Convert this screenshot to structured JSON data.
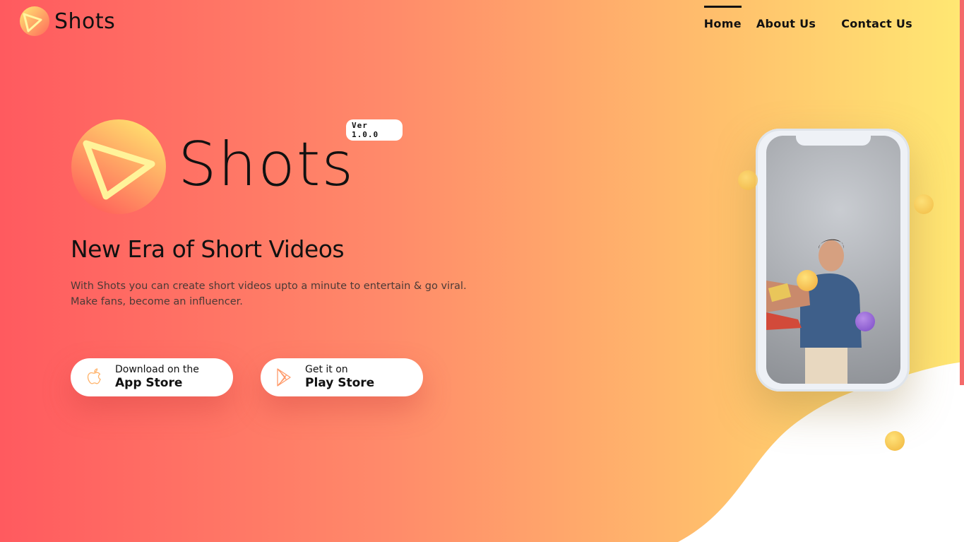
{
  "brand": {
    "name": "Shots",
    "version": "Ver 1.0.0"
  },
  "nav": {
    "items": [
      "Home",
      "About Us",
      "Contact Us"
    ],
    "active": "Home"
  },
  "hero": {
    "headline": "New Era of Short Videos",
    "description_line1": "With Shots you can create short videos upto a minute to entertain & go viral.",
    "description_line2": "Make fans, become an influencer."
  },
  "stores": {
    "apple": {
      "small": "Download on the",
      "big": "App Store",
      "icon": "apple-icon"
    },
    "google": {
      "small": "Get it on",
      "big": "Play Store",
      "icon": "play-store-icon"
    }
  },
  "colors": {
    "gradient_start": "#ff5a5f",
    "gradient_end": "#ffe873",
    "text": "#111111",
    "wave": "#ffffff"
  }
}
